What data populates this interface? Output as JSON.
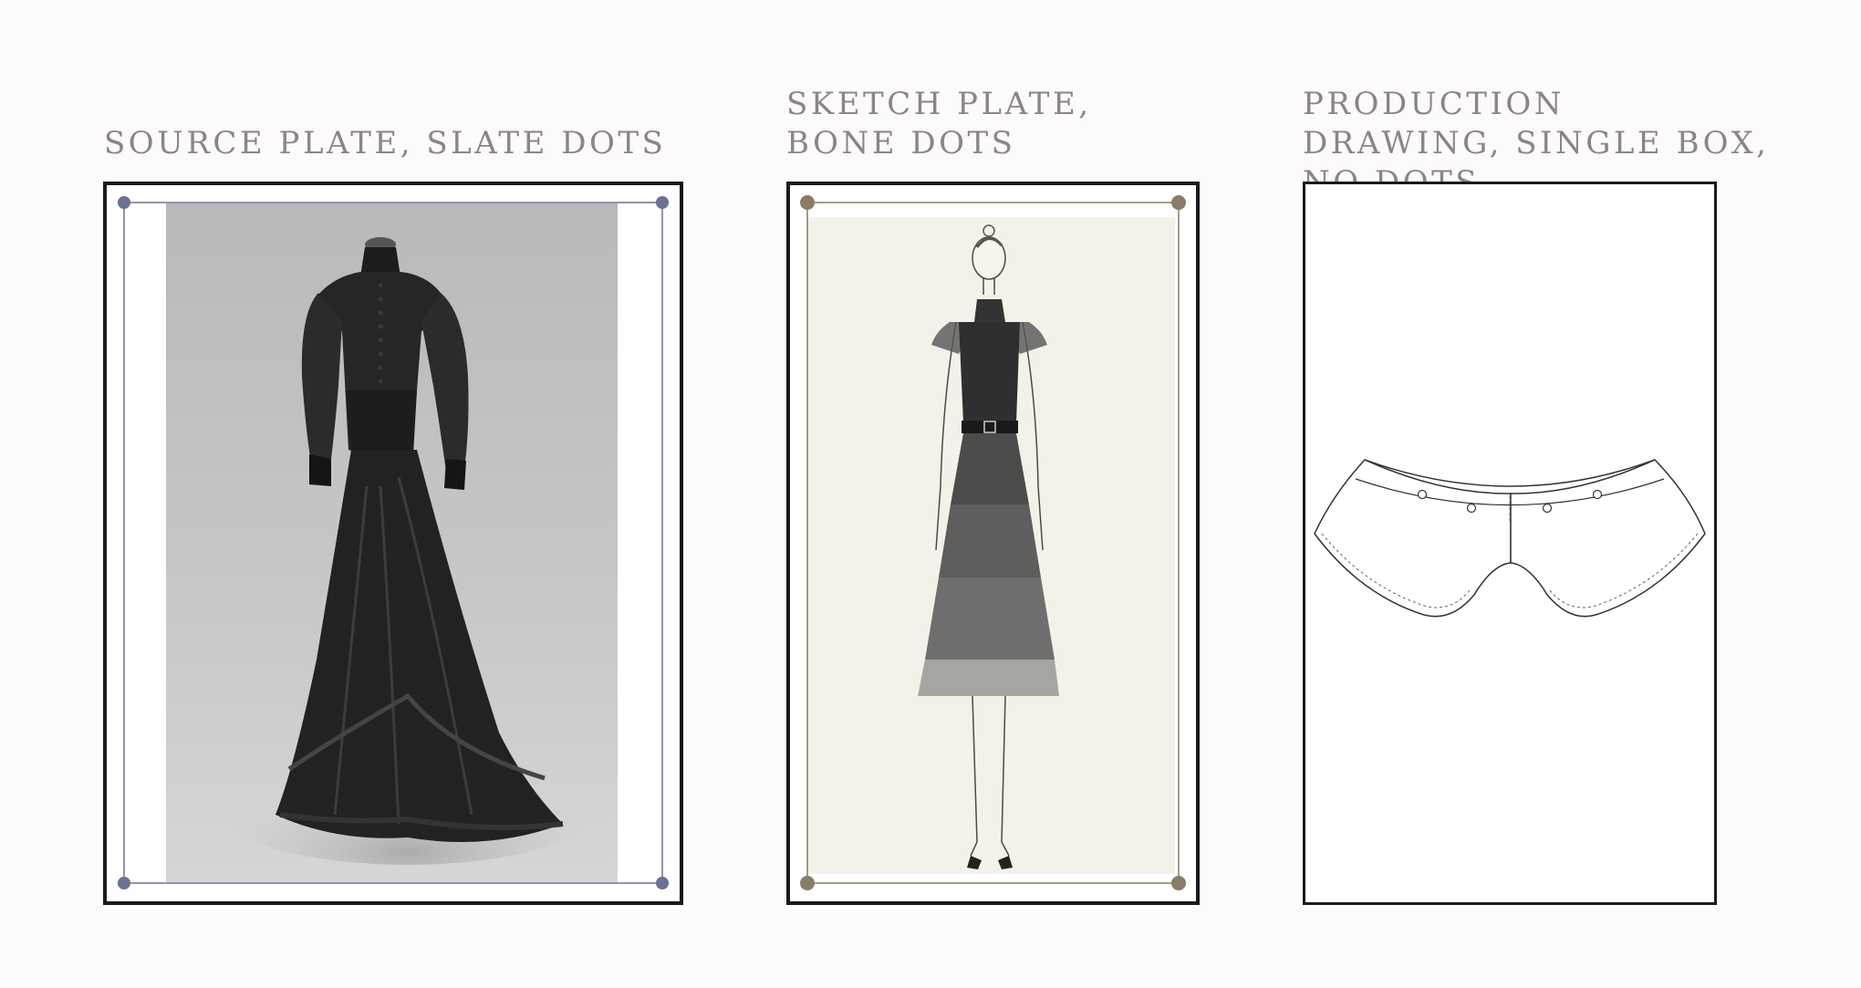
{
  "plates": [
    {
      "caption": "SOURCE PLATE, SLATE DOTS",
      "image": "photograph of a black Victorian long-sleeved gown with high collar, button front and ruffled train on a dress form",
      "dot_color": "#6b7190"
    },
    {
      "caption": "SKETCH PLATE, BONE DOTS",
      "image": "pencil fashion sketch of a figure in a black sleeveless tiered tulle dress with collar, belt and heels",
      "dot_color": "#8a7c67"
    },
    {
      "caption": "PRODUCTION DRAWING, SINGLE BOX, NO DOTS",
      "image": "technical flat drawing of a peter pan collar with four buttonholes"
    }
  ]
}
